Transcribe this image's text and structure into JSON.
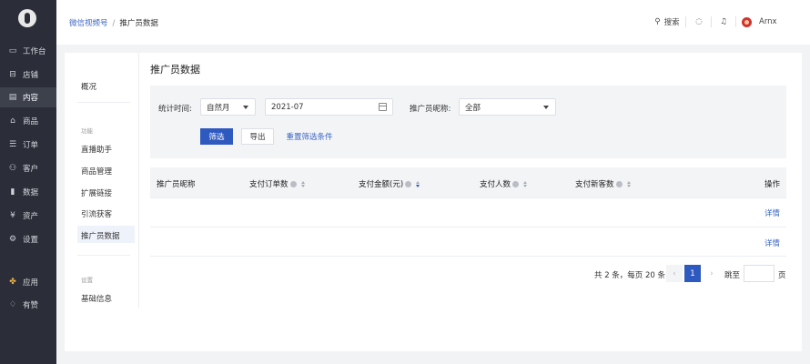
{
  "sidebar": {
    "items": [
      {
        "label": "工作台",
        "icon": "monitor-icon"
      },
      {
        "label": "店铺",
        "icon": "store-icon"
      },
      {
        "label": "内容",
        "icon": "document-icon",
        "active": true
      },
      {
        "label": "商品",
        "icon": "bag-icon"
      },
      {
        "label": "订单",
        "icon": "order-icon"
      },
      {
        "label": "客户",
        "icon": "user-icon"
      },
      {
        "label": "数据",
        "icon": "chart-icon"
      },
      {
        "label": "资产",
        "icon": "asset-icon"
      },
      {
        "label": "设置",
        "icon": "gear-icon"
      }
    ],
    "bottom_items": [
      {
        "label": "应用",
        "icon": "apps-icon"
      },
      {
        "label": "有赞",
        "icon": "thumb-icon"
      }
    ]
  },
  "header": {
    "breadcrumb_link": "微信视频号",
    "breadcrumb_sep": "/",
    "breadcrumb_current": "推广员数据",
    "search_label": "搜索",
    "user_name": "Arnx"
  },
  "subnav": {
    "overview": "概况",
    "group1_title": "功能",
    "group1_items": [
      "直播助手",
      "商品管理",
      "扩展链接",
      "引流获客",
      "推广员数据"
    ],
    "group2_title": "设置",
    "group2_items": [
      "基础信息"
    ]
  },
  "page": {
    "title": "推广员数据"
  },
  "filter": {
    "time_label": "统计时间:",
    "period_value": "自然月",
    "month_value": "2021-07",
    "nickname_label": "推广员昵称:",
    "nickname_value": "全部",
    "filter_button": "筛选",
    "export_button": "导出",
    "reset_link": "重置筛选条件"
  },
  "table": {
    "columns": [
      "推广员昵称",
      "支付订单数",
      "支付金额(元)",
      "支付人数",
      "支付新客数",
      "操作"
    ],
    "rows": [
      {
        "action": "详情"
      },
      {
        "action": "详情"
      }
    ]
  },
  "pagination": {
    "summary": "共 2 条，每页 20 条",
    "current_page": "1",
    "jump_label": "跳至",
    "page_unit": "页"
  }
}
